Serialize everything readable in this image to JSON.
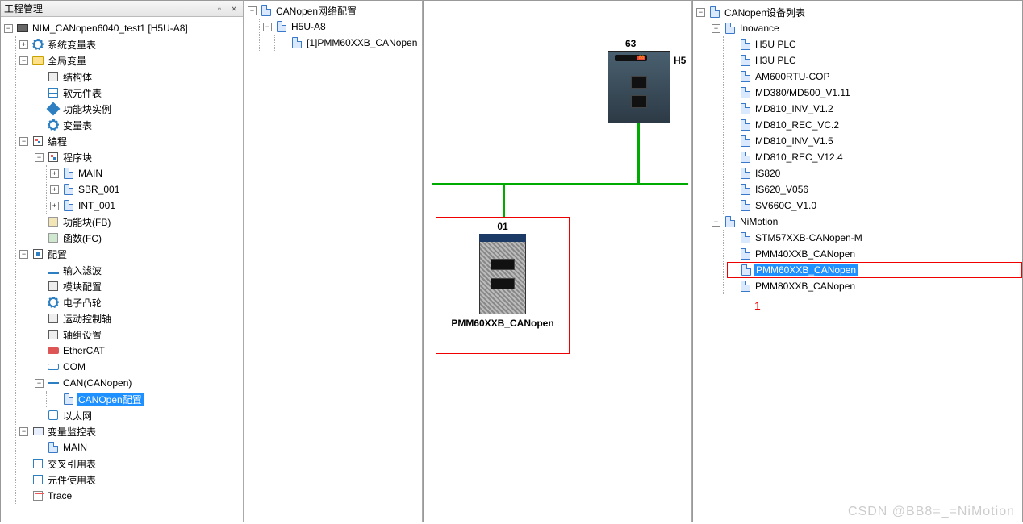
{
  "left_panel": {
    "title": "工程管理",
    "root": "NIM_CANopen6040_test1 [H5U-A8]",
    "nodes": {
      "sys_var": "系统变量表",
      "global_var": "全局变量",
      "struct": "结构体",
      "soft_elem": "软元件表",
      "fb_inst": "功能块实例",
      "var_table": "变量表",
      "programming": "编程",
      "prog_block": "程序块",
      "main": "MAIN",
      "sbr": "SBR_001",
      "int": "INT_001",
      "fb": "功能块(FB)",
      "fc": "函数(FC)",
      "config": "配置",
      "input_filter": "输入滤波",
      "module_cfg": "模块配置",
      "ecam": "电子凸轮",
      "motion_axis": "运动控制轴",
      "axis_group": "轴组设置",
      "ethercat": "EtherCAT",
      "com": "COM",
      "can": "CAN(CANopen)",
      "canopen_cfg": "CANOpen配置",
      "ethernet": "以太网",
      "var_monitor": "变量监控表",
      "monitor_main": "MAIN",
      "xref": "交叉引用表",
      "elem_usage": "元件使用表",
      "trace": "Trace"
    }
  },
  "mid1": {
    "title": "CANopen网络配置",
    "master": "H5U-A8",
    "slave": "[1]PMM60XXB_CANopen"
  },
  "canvas": {
    "master_num": "63",
    "master_label": "H5",
    "slave_num": "01",
    "slave_label": "PMM60XXB_CANopen"
  },
  "right_panel": {
    "title": "CANopen设备列表",
    "groups": {
      "inovance": {
        "name": "Inovance",
        "items": [
          "H5U PLC",
          "H3U PLC",
          "AM600RTU-COP",
          "MD380/MD500_V1.11",
          "MD810_INV_V1.2",
          "MD810_REC_VC.2",
          "MD810_INV_V1.5",
          "MD810_REC_V12.4",
          "IS820",
          "IS620_V056",
          "SV660C_V1.0"
        ]
      },
      "nimotion": {
        "name": "NiMotion",
        "items": [
          "STM57XXB-CANopen-M",
          "PMM40XXB_CANopen",
          "PMM60XXB_CANopen",
          "PMM80XXB_CANopen"
        ]
      }
    },
    "selected_index": 2,
    "annotation": "1"
  },
  "watermark": "CSDN @BB8=_=NiMotion"
}
